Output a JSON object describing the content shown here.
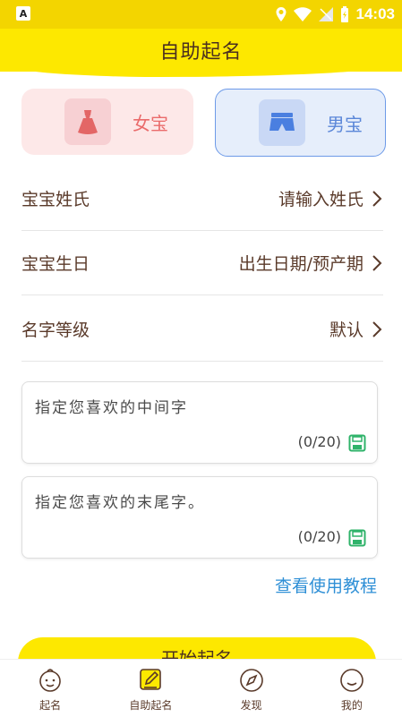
{
  "status_bar": {
    "time": "14:03"
  },
  "header": {
    "title": "自助起名"
  },
  "gender": {
    "girl_label": "女宝",
    "boy_label": "男宝"
  },
  "form": {
    "surname_label": "宝宝姓氏",
    "surname_value": "请输入姓氏",
    "birthday_label": "宝宝生日",
    "birthday_value": "出生日期/预产期",
    "level_label": "名字等级",
    "level_value": "默认"
  },
  "middle_char": {
    "placeholder": "指定您喜欢的中间字",
    "count": "(0/20)"
  },
  "last_char": {
    "placeholder": "指定您喜欢的末尾字。",
    "count": "(0/20)"
  },
  "tutorial_link": "查看使用教程",
  "start_button": "开始起名",
  "bottom_nav": [
    {
      "label": "起名",
      "icon": "baby-face-icon"
    },
    {
      "label": "自助起名",
      "icon": "pencil-icon"
    },
    {
      "label": "发现",
      "icon": "compass-icon"
    },
    {
      "label": "我的",
      "icon": "smiley-icon"
    }
  ],
  "colors": {
    "accent_yellow": "#fde800",
    "girl_pink": "#ea6b6b",
    "boy_blue": "#5a86d8",
    "link_blue": "#2e8fd6",
    "save_green": "#2fb36a"
  }
}
